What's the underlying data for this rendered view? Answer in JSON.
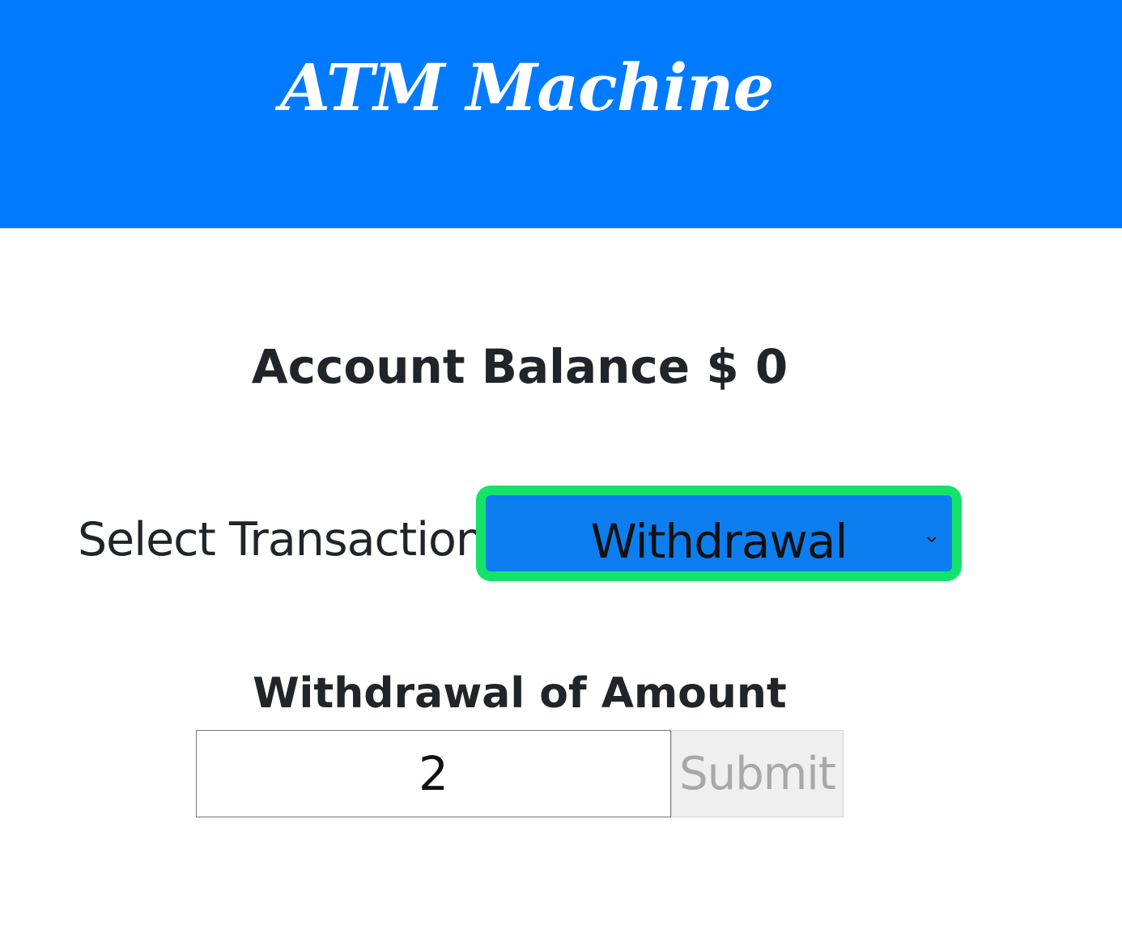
{
  "header": {
    "title": "ATM Machine"
  },
  "account": {
    "balance_text": "Account Balance $ 0"
  },
  "transaction": {
    "label": "Select Transaction",
    "selected": "Withdrawal"
  },
  "amount_form": {
    "heading": "Withdrawal of Amount",
    "value": "2",
    "submit_label": "Submit"
  },
  "colors": {
    "header_bg": "#007bff",
    "select_bg": "#0d7ef0",
    "select_focus_ring": "#14e36a"
  }
}
